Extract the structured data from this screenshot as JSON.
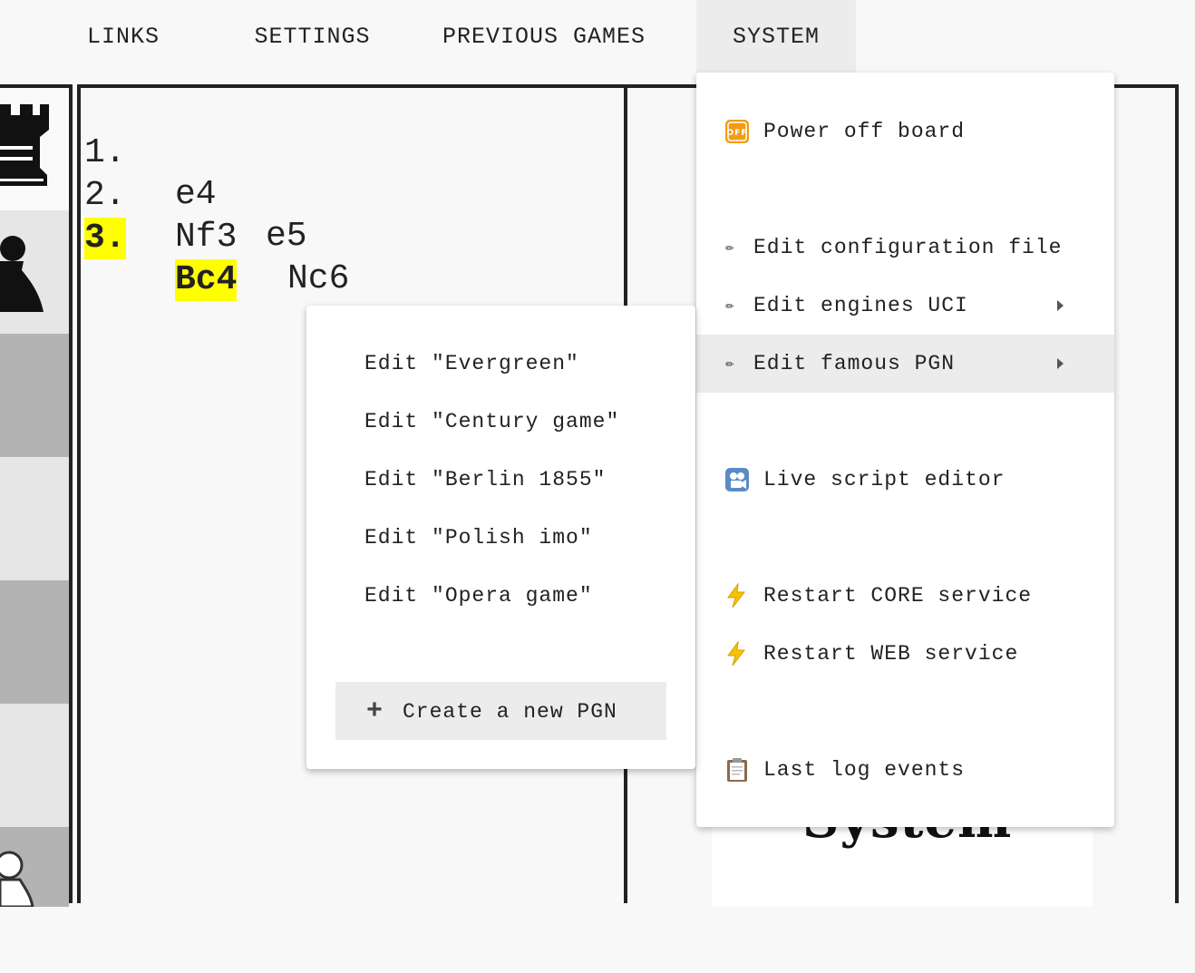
{
  "nav": {
    "links": "LINKS",
    "settings": "SETTINGS",
    "previous_games": "PREVIOUS GAMES",
    "system": "SYSTEM"
  },
  "moves": [
    {
      "num": "1.",
      "white": "e4",
      "black": "e5"
    },
    {
      "num": "2.",
      "white": "Nf3",
      "black": "Nc6"
    },
    {
      "num": "3.",
      "white": "Bc4",
      "black": ""
    }
  ],
  "highlight_color": "#ffff00",
  "system_menu": {
    "power_off": "Power off board",
    "edit_config": "Edit configuration file",
    "edit_engines": "Edit engines UCI",
    "edit_famous_pgn": "Edit famous PGN",
    "live_script": "Live script editor",
    "restart_core": "Restart CORE service",
    "restart_web": "Restart WEB service",
    "last_log": "Last log events",
    "icons": {
      "power_off": "power-off-icon",
      "edit": "pencil-icon",
      "live_script": "camera-icon",
      "restart": "lightning-icon",
      "log": "clipboard-icon"
    }
  },
  "pgn_submenu": {
    "items": [
      "Edit \"Evergreen\"",
      "Edit \"Century game\"",
      "Edit \"Berlin 1855\"",
      "Edit \"Polish imo\"",
      "Edit \"Opera game\""
    ],
    "create": "Create a new PGN"
  },
  "logo_text": "System"
}
